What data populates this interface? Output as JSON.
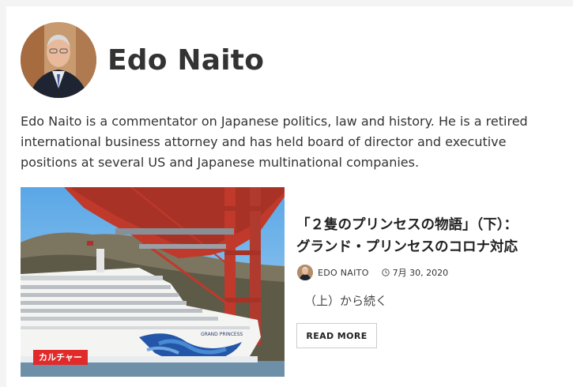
{
  "author": {
    "name": "Edo Naito",
    "bio": "Edo Naito is a commentator on Japanese politics, law and history. He is a retired international business attorney and has held board of director and executive positions at several US and Japanese multinational companies."
  },
  "post": {
    "category": "カルチャー",
    "title_line1": "「２隻のプリンセスの物語」（下）：",
    "title_line2": "グランド・プリンセスのコロナ対応",
    "meta_author": "EDO NAITO",
    "date": "7月 30, 2020",
    "excerpt": "（上）から続く",
    "read_more_label": "READ MORE",
    "ship_name_text": "GRAND PRINCESS"
  },
  "colors": {
    "badge_red": "#e12b2b",
    "bridge_red": "#c0392b",
    "text_dark": "#333333"
  }
}
